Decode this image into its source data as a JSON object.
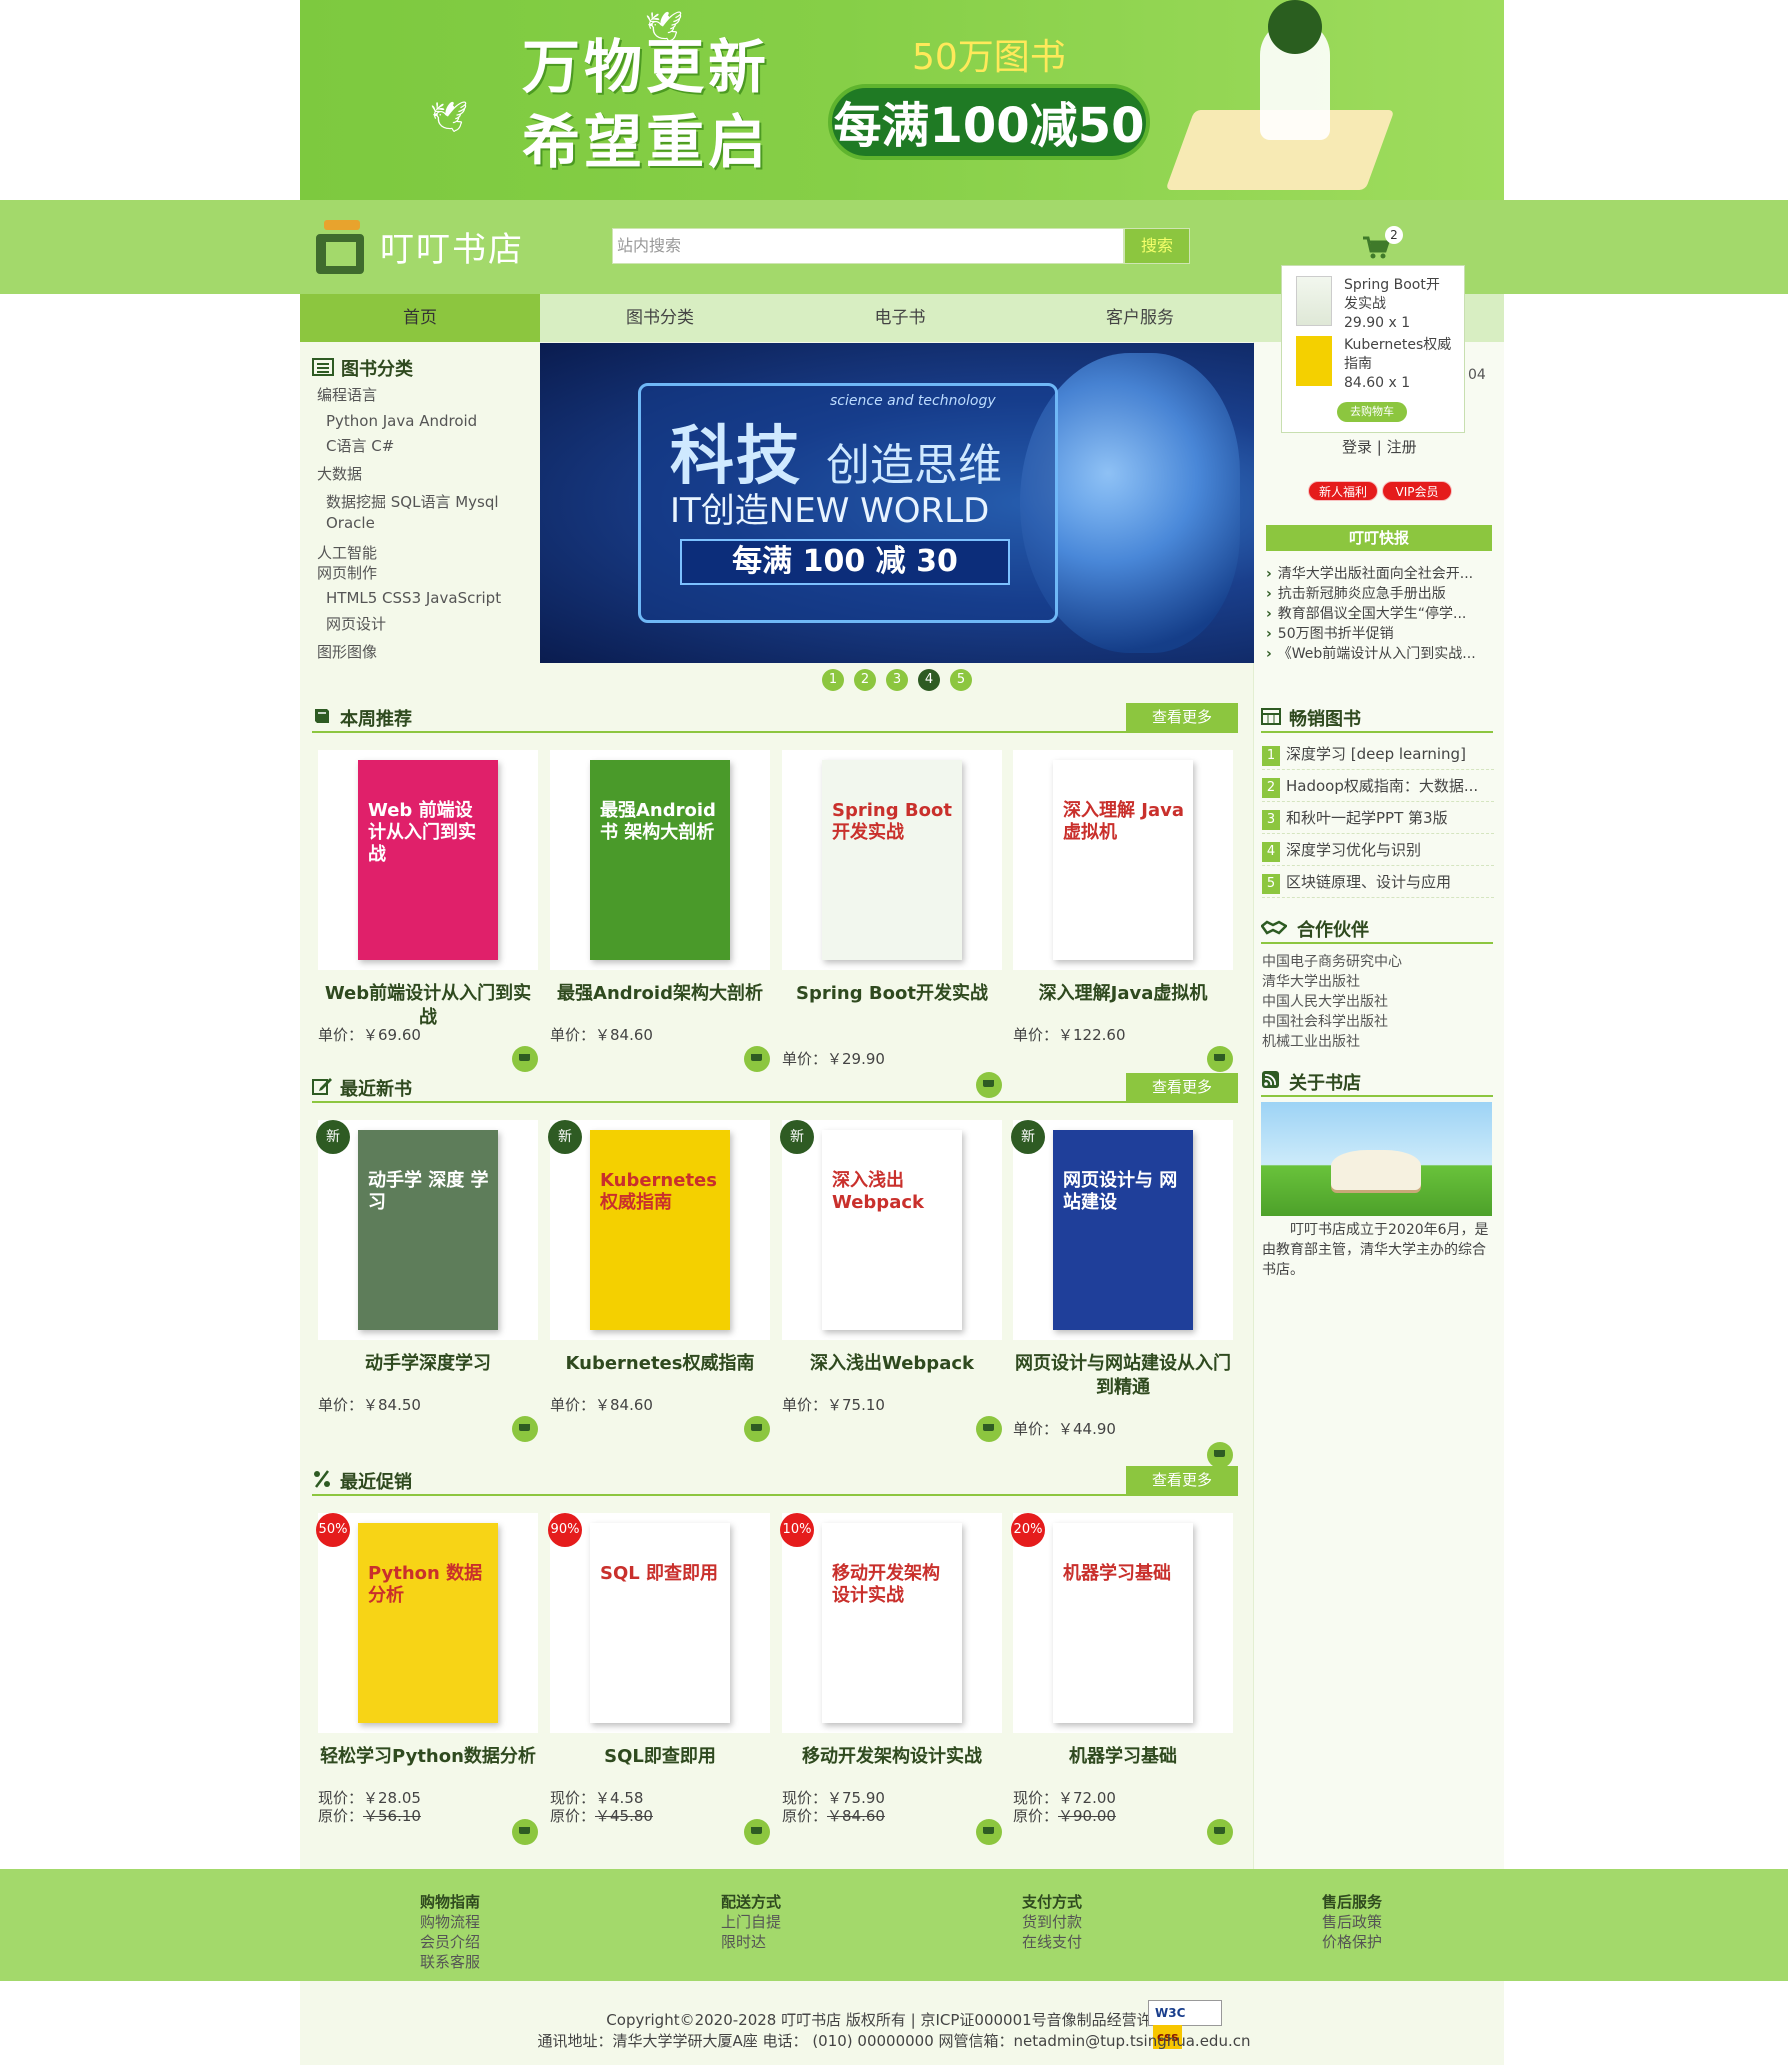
{
  "banner": {
    "line1": "万物更新",
    "line2": "希望重启",
    "books": "50万图书",
    "promo": "每满100减50"
  },
  "header": {
    "shop_name": "叮叮书店",
    "search_placeholder": "站内搜索",
    "search_button": "搜索",
    "cart_count": "2"
  },
  "nav": [
    "首页",
    "图书分类",
    "电子书",
    "客户服务"
  ],
  "categories": {
    "title": "图书分类",
    "lines": [
      "编程语言",
      "Python Java Android",
      "C语言 C#",
      "大数据",
      "数据挖掘 SQL语言 Mysql",
      "Oracle",
      "人工智能",
      "网页制作",
      "HTML5 CSS3 JavaScript",
      "网页设计",
      "图形图像"
    ]
  },
  "carousel": {
    "subtitle": "science and technology",
    "title_big": "科技",
    "title_rest": "创造思维",
    "line2": "IT创造NEW WORLD",
    "promo": "每满 100 减 30",
    "dots": [
      "1",
      "2",
      "3",
      "4",
      "5"
    ],
    "active": 3
  },
  "cart_popup": {
    "items": [
      {
        "name1": "Spring Boot开",
        "name2": "发实战",
        "qty": "29.90 x 1"
      },
      {
        "name1": "Kubernetes权威",
        "name2": "指南",
        "qty": "84.60 x 1"
      }
    ],
    "go_button": "去购物车",
    "behind_text": "04"
  },
  "account": {
    "login": "登录",
    "sep": "|",
    "register": "注册",
    "new_user": "新人福利",
    "vip": "VIP会员"
  },
  "news": {
    "title": "叮叮快报",
    "items": [
      "清华大学出版社面向全社会开...",
      "抗击新冠肺炎应急手册出版",
      "教育部倡议全国大学生“停学...",
      "50万图书折半促销",
      "《Web前端设计从入门到实战..."
    ]
  },
  "sections": {
    "weekly": {
      "title": "本周推荐",
      "more": "查看更多"
    },
    "new": {
      "title": "最近新书",
      "more": "查看更多"
    },
    "sale": {
      "title": "最近促销",
      "more": "查看更多"
    }
  },
  "weekly_books": [
    {
      "title": "Web前端设计从入门到实战",
      "price_label": "单价：",
      "price": "￥69.60",
      "cover_text": "Web 前端设计从入门到实战",
      "color": "#e0206a"
    },
    {
      "title": "最强Android架构大剖析",
      "price_label": "单价：",
      "price": "￥84.60",
      "cover_text": "最强Android书 架构大剖析",
      "color": "#4a9a2a"
    },
    {
      "title": "Spring Boot开发实战",
      "price_label": "单价：",
      "price": "￥29.90",
      "cover_text": "Spring Boot 开发实战",
      "color": "#f2f7ee"
    },
    {
      "title": "深入理解Java虚拟机",
      "price_label": "单价：",
      "price": "￥122.60",
      "cover_text": "深入理解 Java 虚拟机",
      "color": "#ffffff"
    }
  ],
  "new_books": [
    {
      "tag": "新",
      "title": "动手学深度学习",
      "price_label": "单价：",
      "price": "￥84.50",
      "cover_text": "动手学 深度 学习",
      "color": "#5e7d5a"
    },
    {
      "tag": "新",
      "title": "Kubernetes权威指南",
      "price_label": "单价：",
      "price": "￥84.60",
      "cover_text": "Kubernetes 权威指南",
      "color": "#f4d000"
    },
    {
      "tag": "新",
      "title": "深入浅出Webpack",
      "price_label": "单价：",
      "price": "￥75.10",
      "cover_text": "深入浅出 Webpack",
      "color": "#ffffff"
    },
    {
      "tag": "新",
      "title": "网页设计与网站建设从入门到精通",
      "price_label": "单价：",
      "price": "￥44.90",
      "cover_text": "网页设计与 网站建设",
      "color": "#1f3f9a"
    }
  ],
  "sale_books": [
    {
      "tag": "50%",
      "title": "轻松学习Python数据分析",
      "now_label": "现价：",
      "now": "￥28.05",
      "old_label": "原价：",
      "old": "￥56.10",
      "cover_text": "Python 数据分析",
      "color": "#f7d416"
    },
    {
      "tag": "90%",
      "title": "SQL即查即用",
      "now_label": "现价：",
      "now": "￥4.58",
      "old_label": "原价：",
      "old": "￥45.80",
      "cover_text": "SQL 即查即用",
      "color": "#ffffff"
    },
    {
      "tag": "10%",
      "title": "移动开发架构设计实战",
      "now_label": "现价：",
      "now": "￥75.90",
      "old_label": "原价：",
      "old": "￥84.60",
      "cover_text": "移动开发架构设计实战",
      "color": "#ffffff"
    },
    {
      "tag": "20%",
      "title": "机器学习基础",
      "now_label": "现价：",
      "now": "￥72.00",
      "old_label": "原价：",
      "old": "￥90.00",
      "cover_text": "机器学习基础",
      "color": "#ffffff"
    }
  ],
  "bestsellers": {
    "title": "畅销图书",
    "items": [
      "深度学习 [deep learning]",
      "Hadoop权威指南：大数据...",
      "和秋叶一起学PPT 第3版",
      "深度学习优化与识别",
      "区块链原理、设计与应用"
    ]
  },
  "partners": {
    "title": "合作伙伴",
    "items": [
      "中国电子商务研究中心",
      "清华大学出版社",
      "中国人民大学出版社",
      "中国社会科学出版社",
      "机械工业出版社"
    ]
  },
  "about": {
    "title": "关于书店",
    "text": "叮叮书店成立于2020年6月，是由教育部主管，清华大学主办的综合书店。"
  },
  "footer": {
    "cols": [
      {
        "head": "购物指南",
        "items": [
          "购物流程",
          "会员介绍",
          "联系客服"
        ]
      },
      {
        "head": "配送方式",
        "items": [
          "上门自提",
          "限时达"
        ]
      },
      {
        "head": "支付方式",
        "items": [
          "货到付款",
          "在线支付"
        ]
      },
      {
        "head": "售后服务",
        "items": [
          "售后政策",
          "价格保护"
        ]
      }
    ],
    "copyright": "Copyright©2020-2028 叮叮书店 版权所有 | 京ICP证000001号音像制品经营许可证",
    "address": "通讯地址：清华大学学研大厦A座  电话：  (010)  00000000  网管信箱：netadmin@tup.tsinghua.edu.cn",
    "badge_w3c": "W3C",
    "badge_css": "css"
  }
}
